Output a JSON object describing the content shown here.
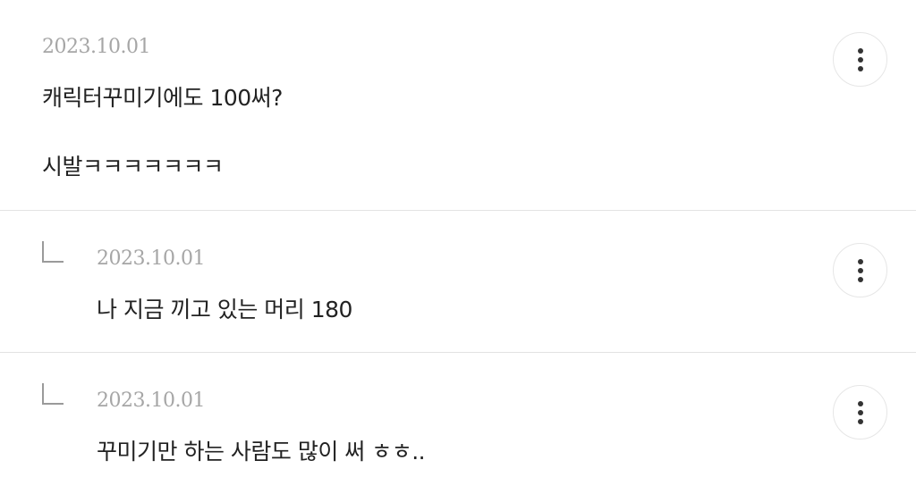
{
  "comments": [
    {
      "date": "2023.10.01",
      "lines": [
        "캐릭터꾸미기에도 100써?",
        "시발ㅋㅋㅋㅋㅋㅋㅋ"
      ],
      "more_icon": "more-vertical-icon"
    },
    {
      "date": "2023.10.01",
      "text": "나 지금 끼고 있는 머리 180",
      "reply_icon": "reply-arrow-icon",
      "more_icon": "more-vertical-icon"
    },
    {
      "date": "2023.10.01",
      "text": "꾸미기만 하는 사람도 많이 써 ㅎㅎ..",
      "reply_icon": "reply-arrow-icon",
      "more_icon": "more-vertical-icon"
    }
  ],
  "colors": {
    "date": "#a6a6a6",
    "text": "#222222",
    "divider": "#e3e3e3",
    "icon": "#333333"
  }
}
